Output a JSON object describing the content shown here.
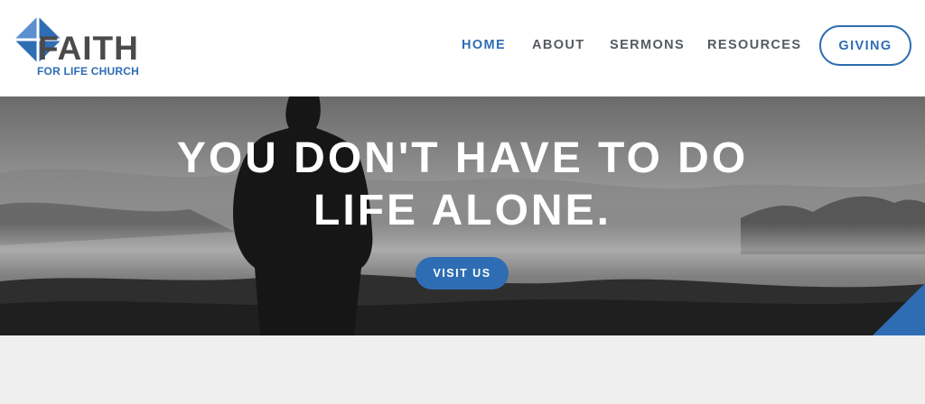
{
  "logo": {
    "word": "FAITH",
    "subtitle": "FOR LIFE CHURCH",
    "icon": "diamond-logo-icon",
    "colors": {
      "blue": "#2e6db4",
      "gray": "#4a4a4a"
    }
  },
  "nav": {
    "items": [
      {
        "label": "HOME",
        "active": true
      },
      {
        "label": "ABOUT",
        "active": false
      },
      {
        "label": "SERMONS",
        "active": false
      },
      {
        "label": "RESOURCES",
        "active": false
      }
    ],
    "giving_label": "GIVING"
  },
  "hero": {
    "title_line1": "YOU DON'T HAVE TO DO",
    "title_line2": "LIFE ALONE.",
    "cta_label": "VISIT US",
    "background": "silhouette-over-misty-mountains"
  },
  "colors": {
    "accent": "#2e6db4",
    "nav_text": "#555a61",
    "lower_bg": "#efefef"
  }
}
